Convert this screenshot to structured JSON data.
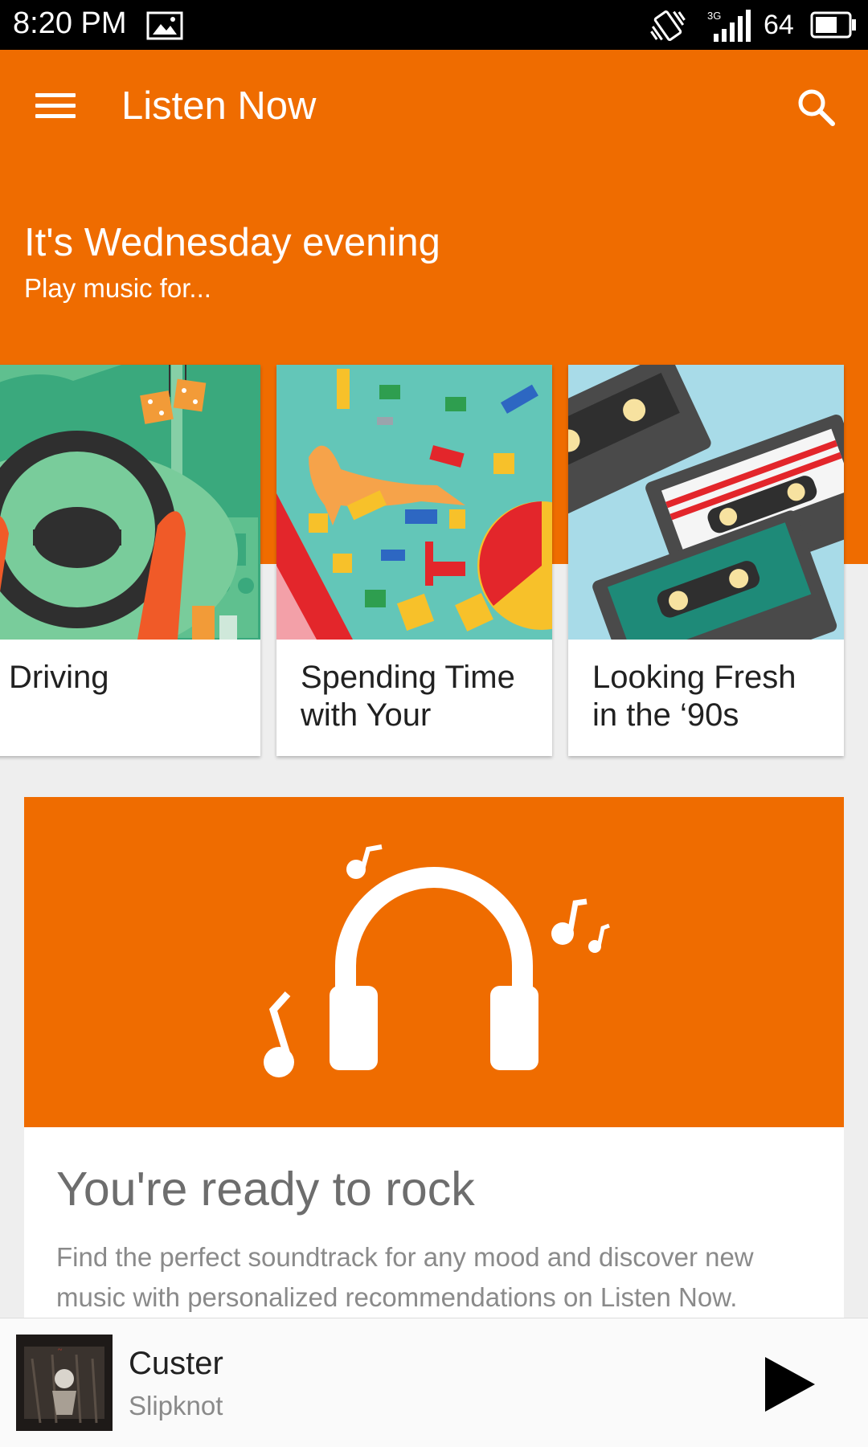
{
  "status_bar": {
    "time": "8:20 PM",
    "network": "3G",
    "battery": "64",
    "icons": [
      "image-icon",
      "vibrate-icon",
      "signal-icon",
      "battery-icon"
    ]
  },
  "app_bar": {
    "title": "Listen Now",
    "menu_icon": "menu-icon",
    "search_icon": "search-icon"
  },
  "header": {
    "greeting": "It's Wednesday evening",
    "subtitle": "Play music for..."
  },
  "activity_cards": [
    {
      "label": "Driving"
    },
    {
      "label": "Spending Time with Your"
    },
    {
      "label": "Looking Fresh in the ‘90s"
    }
  ],
  "promo": {
    "icon": "headphones-icon",
    "title": "You're ready to rock",
    "text": "Find the perfect soundtrack for any mood and discover new music with personalized recommendations on Listen Now."
  },
  "now_playing": {
    "title": "Custer",
    "artist": "Slipknot",
    "play_icon": "play-icon"
  },
  "colors": {
    "accent": "#ef6c00",
    "background": "#eeeeee",
    "status_bar": "#000000"
  }
}
